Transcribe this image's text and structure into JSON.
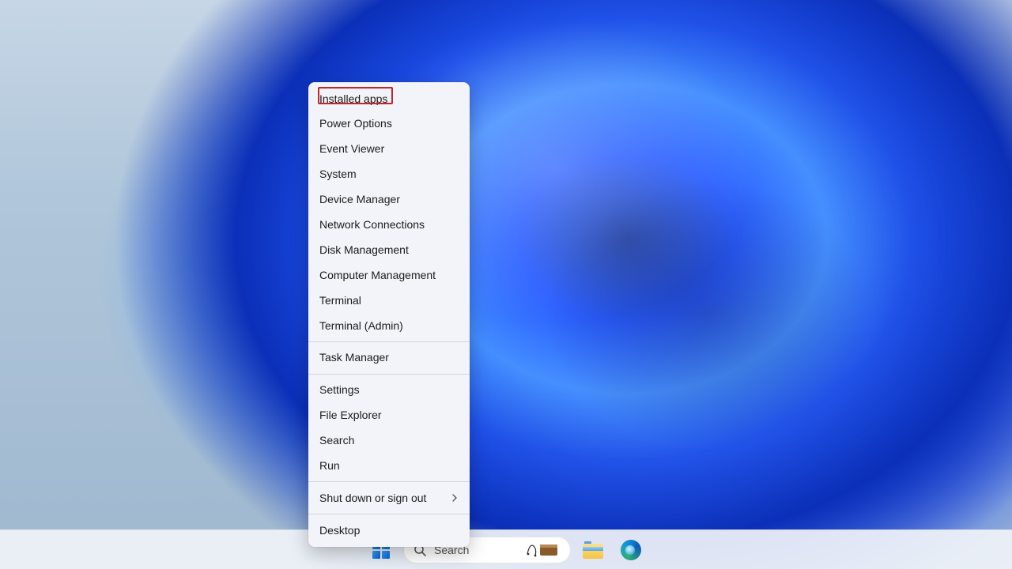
{
  "context_menu": {
    "groups": [
      [
        {
          "label": "Installed apps",
          "highlighted": true
        },
        {
          "label": "Power Options"
        },
        {
          "label": "Event Viewer"
        },
        {
          "label": "System"
        },
        {
          "label": "Device Manager"
        },
        {
          "label": "Network Connections"
        },
        {
          "label": "Disk Management"
        },
        {
          "label": "Computer Management"
        },
        {
          "label": "Terminal"
        },
        {
          "label": "Terminal (Admin)"
        }
      ],
      [
        {
          "label": "Task Manager"
        }
      ],
      [
        {
          "label": "Settings"
        },
        {
          "label": "File Explorer"
        },
        {
          "label": "Search"
        },
        {
          "label": "Run"
        }
      ],
      [
        {
          "label": "Shut down or sign out",
          "submenu": true
        }
      ],
      [
        {
          "label": "Desktop"
        }
      ]
    ]
  },
  "taskbar": {
    "search_placeholder": "Search",
    "items": [
      {
        "name": "start-button"
      },
      {
        "name": "search-box"
      },
      {
        "name": "file-explorer-button"
      },
      {
        "name": "edge-button"
      }
    ]
  }
}
